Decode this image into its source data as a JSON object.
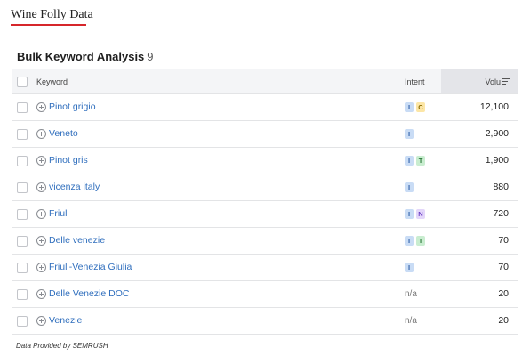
{
  "brand": {
    "title": "Wine Folly Data",
    "accent_color": "#d6262b"
  },
  "panel": {
    "title": "Bulk Keyword Analysis",
    "count": "9"
  },
  "table": {
    "headers": {
      "keyword": "Keyword",
      "intent": "Intent",
      "volume": "Volu"
    },
    "sort_icon": "sort-descending-icon",
    "rows": [
      {
        "keyword": "Pinot grigio",
        "intents": [
          "I",
          "C"
        ],
        "volume": "12,100"
      },
      {
        "keyword": "Veneto",
        "intents": [
          "I"
        ],
        "volume": "2,900"
      },
      {
        "keyword": "Pinot gris",
        "intents": [
          "I",
          "T"
        ],
        "volume": "1,900"
      },
      {
        "keyword": "vicenza italy",
        "intents": [
          "I"
        ],
        "volume": "880"
      },
      {
        "keyword": "Friuli",
        "intents": [
          "I",
          "N"
        ],
        "volume": "720"
      },
      {
        "keyword": "Delle venezie",
        "intents": [
          "I",
          "T"
        ],
        "volume": "70"
      },
      {
        "keyword": "Friuli-Venezia Giulia",
        "intents": [
          "I"
        ],
        "volume": "70"
      },
      {
        "keyword": "Delle Venezie DOC",
        "intents": [],
        "intent_na": "n/a",
        "volume": "20"
      },
      {
        "keyword": "Venezie",
        "intents": [],
        "intent_na": "n/a",
        "volume": "20"
      }
    ]
  },
  "intent_colors": {
    "I": {
      "bg": "#c9dcf5",
      "fg": "#2e5fa8"
    },
    "C": {
      "bg": "#fce6a6",
      "fg": "#8a6a00"
    },
    "T": {
      "bg": "#c9edd0",
      "fg": "#2c7a3a"
    },
    "N": {
      "bg": "#e3d6fa",
      "fg": "#6b3fc4"
    }
  },
  "footer": {
    "note": "Data Provided by SEMRUSH"
  }
}
